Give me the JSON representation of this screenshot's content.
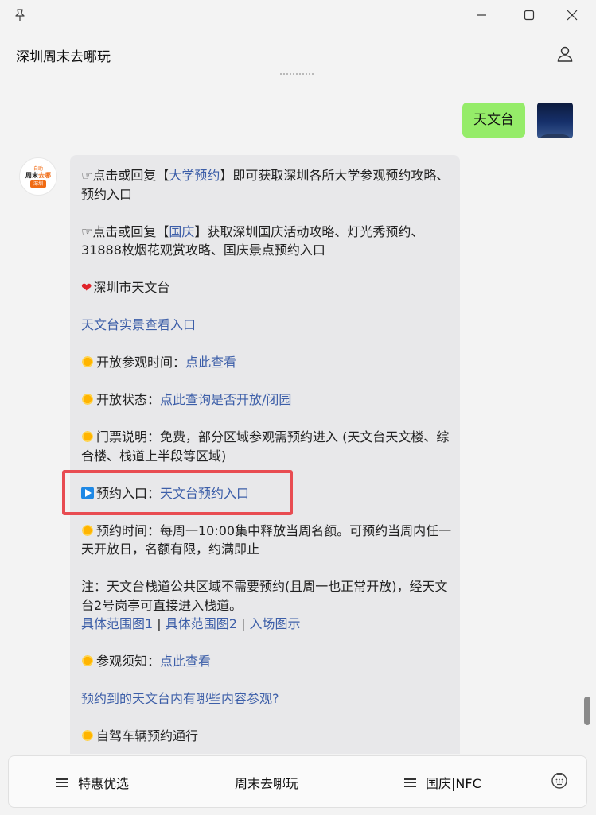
{
  "window": {
    "title": "深圳周末去哪玩",
    "controls": [
      "minimize-icon",
      "maximize-icon",
      "close-icon"
    ]
  },
  "chat": {
    "user_message": "天文台",
    "bot_message": {
      "lines": {
        "l1_pre": "☞点击或回复【",
        "l1_link": "大学预约",
        "l1_post": "】即可获取深圳各所大学参观预约攻略、预约入口",
        "l2_pre": "☞点击或回复【",
        "l2_link": "国庆",
        "l2_post": "】获取深圳国庆活动攻略、灯光秀预约、31888枚烟花观赏攻略、国庆景点预约入口",
        "l3": "深圳市天文台",
        "l4_link": "天文台实景查看入口",
        "l5_label": "开放参观时间：",
        "l5_link": "点此查看",
        "l6_label": "开放状态：",
        "l6_link": "点此查询是否开放/闭园",
        "l7": "门票说明：免费，部分区域参观需预约进入 (天文台天文楼、综合楼、栈道上半段等区域)",
        "l8_label": "预约入口：",
        "l8_link": "天文台预约入口",
        "l9": "预约时间：每周一10:00集中释放当周名额。可预约当周内任一天开放日，名额有限，约满即止",
        "l10": "注：天文台栈道公共区域不需要预约(且周一也正常开放)，经天文台2号岗亭可直接进入栈道。",
        "l10_link1": "具体范围图1",
        "l10_link2": "具体范围图2",
        "l10_link3": "入场图示",
        "sep": "|",
        "l11_label": "参观须知：",
        "l11_link": "点此查看",
        "l12_link": "预约到的天文台内有哪些内容参观?",
        "l13": "自驾车辆预约通行"
      }
    },
    "bot_avatar": {
      "line1": "自助",
      "line2_a": "周末",
      "line2_b": "去哪",
      "line3": "深圳"
    }
  },
  "bottom_menu": {
    "item1": "特惠优选",
    "item2": "周末去哪玩",
    "item3": "国庆|NFC"
  },
  "colors": {
    "user_bubble": "#95ec69",
    "link": "#3c5ea8",
    "highlight": "#e84c52"
  }
}
